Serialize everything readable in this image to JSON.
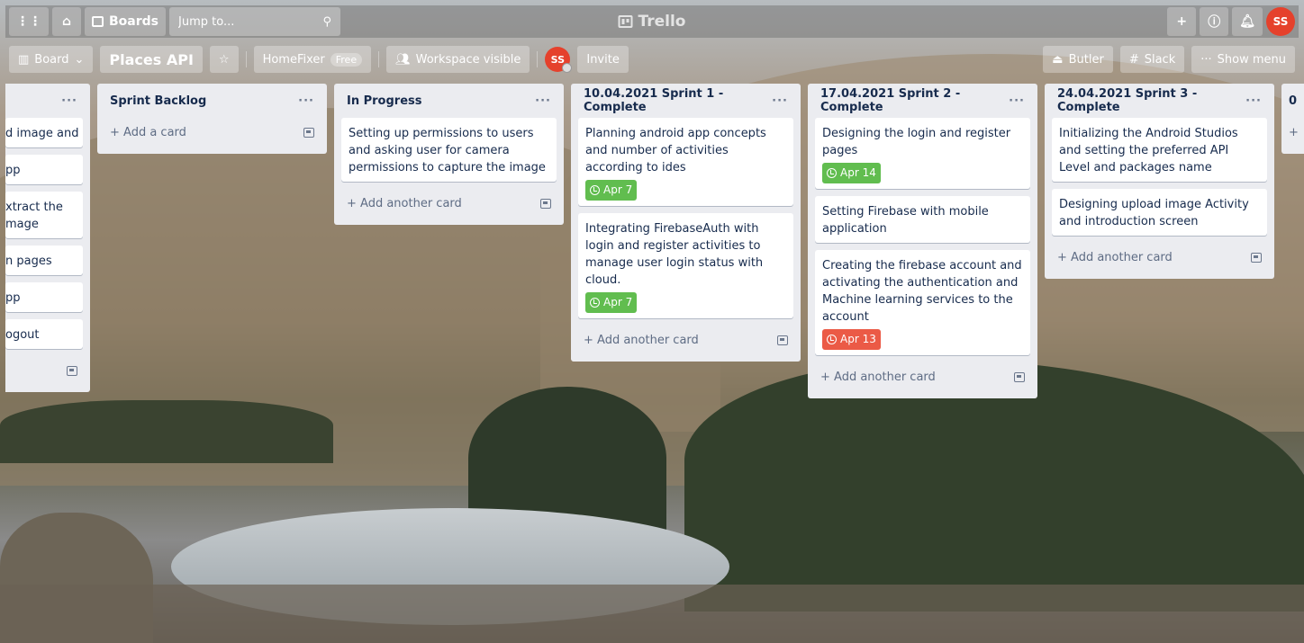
{
  "header": {
    "boards_label": "Boards",
    "jump_placeholder": "Jump to...",
    "logo_text": "Trello",
    "user_initials": "SS"
  },
  "board": {
    "view_label": "Board",
    "name": "Places API",
    "workspace": "HomeFixer",
    "plan_badge": "Free",
    "visibility": "Workspace visible",
    "member_initials": "SS",
    "invite_label": "Invite",
    "butler_label": "Butler",
    "slack_label": "Slack",
    "menu_label": "Show menu"
  },
  "partial_list": {
    "cards": [
      "d image and",
      "pp",
      "xtract the",
      "mage",
      "n pages",
      "pp",
      "ogout"
    ]
  },
  "lists": [
    {
      "title": "Sprint Backlog",
      "cards": [],
      "add_label": "Add a card"
    },
    {
      "title": "In Progress",
      "cards": [
        {
          "text": "Setting up permissions to users and asking user for camera permissions to capture the image",
          "due": "",
          "due_color": ""
        }
      ],
      "add_label": "Add another card"
    },
    {
      "title": "10.04.2021 Sprint 1 - Complete",
      "cards": [
        {
          "text": "Planning android app concepts and number of activities according to ides",
          "due": "Apr 7",
          "due_color": "green"
        },
        {
          "text": "Integrating FirebaseAuth with login and register activities to manage user login status with cloud.",
          "due": "Apr 7",
          "due_color": "green"
        }
      ],
      "add_label": "Add another card"
    },
    {
      "title": "17.04.2021 Sprint 2 - Complete",
      "cards": [
        {
          "text": "Designing the login and register pages",
          "due": "Apr 14",
          "due_color": "green"
        },
        {
          "text": "Setting Firebase with mobile application",
          "due": "",
          "due_color": ""
        },
        {
          "text": "Creating the firebase account and activating the authentication and Machine learning services to the account",
          "due": "Apr 13",
          "due_color": "red"
        }
      ],
      "add_label": "Add another card"
    },
    {
      "title": "24.04.2021 Sprint 3 - Complete",
      "cards": [
        {
          "text": "Initializing the Android Studios and setting the preferred API Level and packages name",
          "due": "",
          "due_color": ""
        },
        {
          "text": "Designing upload image Activity and introduction screen",
          "due": "",
          "due_color": ""
        }
      ],
      "add_label": "Add another card"
    }
  ],
  "next_list_partial_title": "0"
}
